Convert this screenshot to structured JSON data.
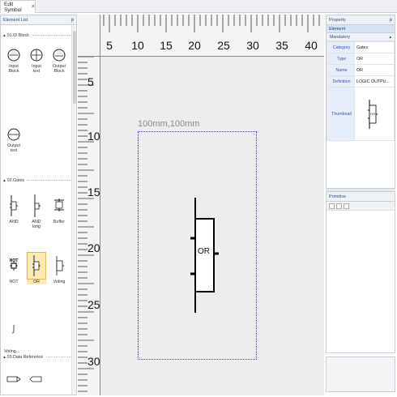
{
  "tabs": {
    "active_tab": "Edit Symbol",
    "close_glyph": "×"
  },
  "element_list": {
    "title": "Element List",
    "pin_glyph": "ᵽ",
    "sections": [
      {
        "label": "01.ID Block",
        "arrow": "▴"
      },
      {
        "label": "02.Gates",
        "arrow": "▴"
      },
      {
        "label": "03.Data Reference",
        "arrow": "▴"
      }
    ],
    "tools": [
      {
        "label": "Input\nBlock"
      },
      {
        "label": "Input\ntext"
      },
      {
        "label": "Output\nBlock"
      },
      {
        "label": "Output\ntext"
      },
      {
        "label": "AND"
      },
      {
        "label": "AND\nlong"
      },
      {
        "label": "Buffer"
      },
      {
        "label": "NOT"
      },
      {
        "label": "OR"
      },
      {
        "label": "Voting"
      },
      {
        "label": "Voting..."
      }
    ]
  },
  "canvas": {
    "h_ticks": [
      "5",
      "10",
      "15",
      "20",
      "25",
      "30",
      "35",
      "40"
    ],
    "v_ticks": [
      "5",
      "10",
      "15",
      "20",
      "25",
      "30"
    ],
    "symbol_size_label": "100mm,100mm",
    "symbol_text": "OR"
  },
  "property": {
    "title": "Property",
    "pin_glyph": "ᵽ",
    "subtitle": "Element",
    "group": "Mandatory",
    "group_arrow": "▴",
    "rows": [
      {
        "key": "Category",
        "value": "Gates"
      },
      {
        "key": "Type",
        "value": "OR"
      },
      {
        "key": "Name",
        "value": "OR"
      },
      {
        "key": "Definition",
        "value": "LOGIC OUTPU..."
      },
      {
        "key": "Thumbnail",
        "value": ""
      }
    ],
    "thumbnail_text": "OR"
  },
  "primitive": {
    "title": "Primitive"
  }
}
